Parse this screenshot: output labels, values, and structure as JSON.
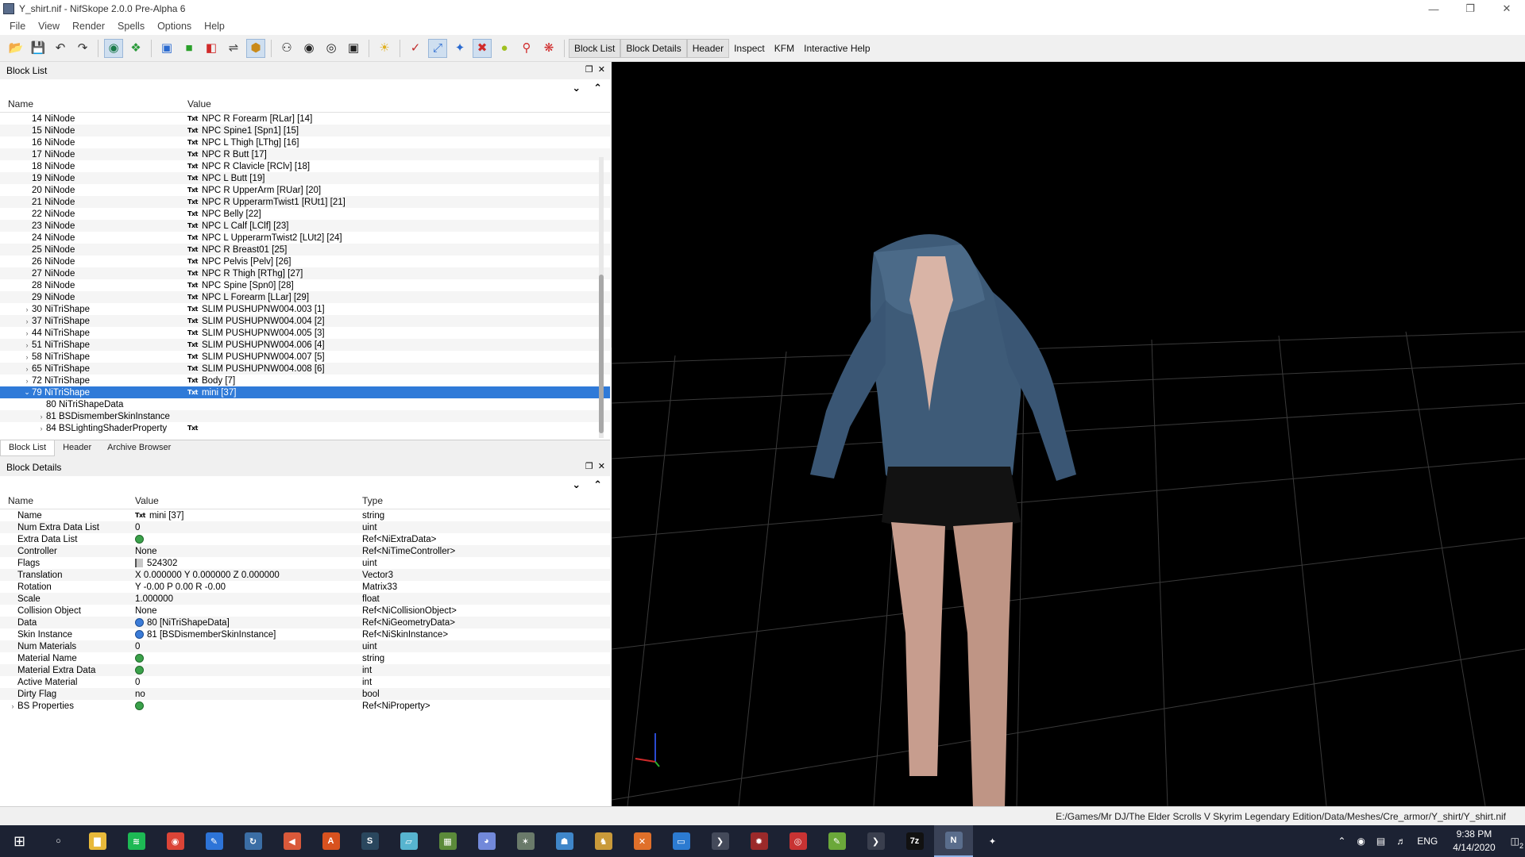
{
  "window": {
    "title": "Y_shirt.nif - NifSkope 2.0.0 Pre-Alpha 6"
  },
  "menu": [
    "File",
    "View",
    "Render",
    "Spells",
    "Options",
    "Help"
  ],
  "toolbar": {
    "labels": [
      "Block List",
      "Block Details",
      "Header",
      "Inspect",
      "KFM",
      "Interactive Help"
    ]
  },
  "block_list": {
    "title": "Block List",
    "col_name": "Name",
    "col_value": "Value",
    "rows": [
      {
        "name": "14 NiNode",
        "value": "NPC R Forearm [RLar] [14]",
        "indent": 1,
        "arrow": ""
      },
      {
        "name": "15 NiNode",
        "value": "NPC Spine1 [Spn1] [15]",
        "indent": 1,
        "arrow": ""
      },
      {
        "name": "16 NiNode",
        "value": "NPC L Thigh [LThg] [16]",
        "indent": 1,
        "arrow": ""
      },
      {
        "name": "17 NiNode",
        "value": "NPC R Butt [17]",
        "indent": 1,
        "arrow": ""
      },
      {
        "name": "18 NiNode",
        "value": "NPC R Clavicle [RClv] [18]",
        "indent": 1,
        "arrow": ""
      },
      {
        "name": "19 NiNode",
        "value": "NPC L Butt [19]",
        "indent": 1,
        "arrow": ""
      },
      {
        "name": "20 NiNode",
        "value": "NPC R UpperArm [RUar] [20]",
        "indent": 1,
        "arrow": ""
      },
      {
        "name": "21 NiNode",
        "value": "NPC R UpperarmTwist1 [RUt1] [21]",
        "indent": 1,
        "arrow": ""
      },
      {
        "name": "22 NiNode",
        "value": "NPC Belly [22]",
        "indent": 1,
        "arrow": ""
      },
      {
        "name": "23 NiNode",
        "value": "NPC L Calf [LClf] [23]",
        "indent": 1,
        "arrow": ""
      },
      {
        "name": "24 NiNode",
        "value": "NPC L UpperarmTwist2 [LUt2] [24]",
        "indent": 1,
        "arrow": ""
      },
      {
        "name": "25 NiNode",
        "value": "NPC R Breast01 [25]",
        "indent": 1,
        "arrow": ""
      },
      {
        "name": "26 NiNode",
        "value": "NPC Pelvis [Pelv] [26]",
        "indent": 1,
        "arrow": ""
      },
      {
        "name": "27 NiNode",
        "value": "NPC R Thigh [RThg] [27]",
        "indent": 1,
        "arrow": ""
      },
      {
        "name": "28 NiNode",
        "value": "NPC Spine [Spn0] [28]",
        "indent": 1,
        "arrow": ""
      },
      {
        "name": "29 NiNode",
        "value": "NPC L Forearm [LLar] [29]",
        "indent": 1,
        "arrow": ""
      },
      {
        "name": "30 NiTriShape",
        "value": "SLIM PUSHUPNW004.003 [1]",
        "indent": 1,
        "arrow": "›"
      },
      {
        "name": "37 NiTriShape",
        "value": "SLIM PUSHUPNW004.004 [2]",
        "indent": 1,
        "arrow": "›"
      },
      {
        "name": "44 NiTriShape",
        "value": "SLIM PUSHUPNW004.005 [3]",
        "indent": 1,
        "arrow": "›"
      },
      {
        "name": "51 NiTriShape",
        "value": "SLIM PUSHUPNW004.006 [4]",
        "indent": 1,
        "arrow": "›"
      },
      {
        "name": "58 NiTriShape",
        "value": "SLIM PUSHUPNW004.007 [5]",
        "indent": 1,
        "arrow": "›"
      },
      {
        "name": "65 NiTriShape",
        "value": "SLIM PUSHUPNW004.008 [6]",
        "indent": 1,
        "arrow": "›"
      },
      {
        "name": "72 NiTriShape",
        "value": "Body [7]",
        "indent": 1,
        "arrow": "›"
      },
      {
        "name": "79 NiTriShape",
        "value": "mini [37]",
        "indent": 1,
        "arrow": "⌄",
        "selected": true
      },
      {
        "name": "80 NiTriShapeData",
        "value": "",
        "indent": 2,
        "arrow": "",
        "noicon": true
      },
      {
        "name": "81 BSDismemberSkinInstance",
        "value": "",
        "indent": 2,
        "arrow": "›",
        "noicon": true
      },
      {
        "name": "84 BSLightingShaderProperty",
        "value": "",
        "indent": 2,
        "arrow": "›"
      }
    ],
    "tabs": [
      "Block List",
      "Header",
      "Archive Browser"
    ]
  },
  "block_details": {
    "title": "Block Details",
    "col_name": "Name",
    "col_value": "Value",
    "col_type": "Type",
    "rows": [
      {
        "name": "Name",
        "value": "mini [37]",
        "type": "string",
        "icon": "txt"
      },
      {
        "name": "Num Extra Data List",
        "value": "0",
        "type": "uint",
        "icon": ""
      },
      {
        "name": "Extra Data List",
        "value": "",
        "type": "Ref<NiExtraData>",
        "icon": "ref"
      },
      {
        "name": "Controller",
        "value": "None",
        "type": "Ref<NiTimeController>",
        "icon": ""
      },
      {
        "name": "Flags",
        "value": "524302",
        "type": "uint",
        "icon": "flag"
      },
      {
        "name": "Translation",
        "value": "X 0.000000 Y 0.000000 Z 0.000000",
        "type": "Vector3",
        "icon": ""
      },
      {
        "name": "Rotation",
        "value": "Y -0.00 P 0.00 R -0.00",
        "type": "Matrix33",
        "icon": ""
      },
      {
        "name": "Scale",
        "value": "1.000000",
        "type": "float",
        "icon": ""
      },
      {
        "name": "Collision Object",
        "value": "None",
        "type": "Ref<NiCollisionObject>",
        "icon": ""
      },
      {
        "name": "Data",
        "value": "80 [NiTriShapeData]",
        "type": "Ref<NiGeometryData>",
        "icon": "link"
      },
      {
        "name": "Skin Instance",
        "value": "81 [BSDismemberSkinInstance]",
        "type": "Ref<NiSkinInstance>",
        "icon": "link"
      },
      {
        "name": "Num Materials",
        "value": "0",
        "type": "uint",
        "icon": ""
      },
      {
        "name": "Material Name",
        "value": "",
        "type": "string",
        "icon": "ref"
      },
      {
        "name": "Material Extra Data",
        "value": "",
        "type": "int",
        "icon": "ref"
      },
      {
        "name": "Active Material",
        "value": "0",
        "type": "int",
        "icon": ""
      },
      {
        "name": "Dirty Flag",
        "value": "no",
        "type": "bool",
        "icon": ""
      },
      {
        "name": "BS Properties",
        "value": "",
        "type": "Ref<NiProperty>",
        "icon": "ref",
        "arrow": "›"
      }
    ]
  },
  "status": {
    "path": "E:/Games/Mr DJ/The Elder Scrolls V Skyrim Legendary Edition/Data/Meshes/Cre_armor/Y_shirt/Y_shirt.nif"
  },
  "tray": {
    "lang": "ENG",
    "time": "9:38 PM",
    "date": "4/14/2020",
    "notif": "2"
  },
  "taskbar_apps": [
    {
      "name": "cortana-search",
      "glyph": "○",
      "color": "#1c2233"
    },
    {
      "name": "file-explorer",
      "glyph": "▇",
      "color": "#e8b93a"
    },
    {
      "name": "spotify",
      "glyph": "≋",
      "color": "#1db954"
    },
    {
      "name": "chrome",
      "glyph": "◉",
      "color": "#db4437"
    },
    {
      "name": "app-blue",
      "glyph": "✎",
      "color": "#2d74d8"
    },
    {
      "name": "steam-ring",
      "glyph": "↻",
      "color": "#3b6ea5"
    },
    {
      "name": "app-red-triangle",
      "glyph": "◀",
      "color": "#d9593a"
    },
    {
      "name": "app-orange",
      "glyph": "A",
      "color": "#d8521f"
    },
    {
      "name": "steam",
      "glyph": "S",
      "color": "#2a475e"
    },
    {
      "name": "app-cyan",
      "glyph": "▱",
      "color": "#57b4cf"
    },
    {
      "name": "minecraft",
      "glyph": "▦",
      "color": "#5b8a3a"
    },
    {
      "name": "discord",
      "glyph": "◕",
      "color": "#7289da"
    },
    {
      "name": "app-gear",
      "glyph": "✶",
      "color": "#6a7a6a"
    },
    {
      "name": "app-figure",
      "glyph": "☗",
      "color": "#3f86c9"
    },
    {
      "name": "app-creature",
      "glyph": "♞",
      "color": "#c99a3a"
    },
    {
      "name": "app-orange-x",
      "glyph": "✕",
      "color": "#e0702a"
    },
    {
      "name": "app-window",
      "glyph": "▭",
      "color": "#2c7bd1"
    },
    {
      "name": "app-arrow",
      "glyph": "❯",
      "color": "#444a5a"
    },
    {
      "name": "app-red-gear",
      "glyph": "✹",
      "color": "#9b2a2a"
    },
    {
      "name": "app-vortex",
      "glyph": "◎",
      "color": "#c83333"
    },
    {
      "name": "notepad-plus",
      "glyph": "✎",
      "color": "#6ba83a"
    },
    {
      "name": "app-arrow-2",
      "glyph": "❯",
      "color": "#3a3f4e"
    },
    {
      "name": "7zip",
      "glyph": "7z",
      "color": "#111111"
    },
    {
      "name": "nifskope",
      "glyph": "N",
      "color": "#5a6d8c",
      "active": true
    },
    {
      "name": "skyrim",
      "glyph": "✦",
      "color": "#1c2233"
    }
  ]
}
